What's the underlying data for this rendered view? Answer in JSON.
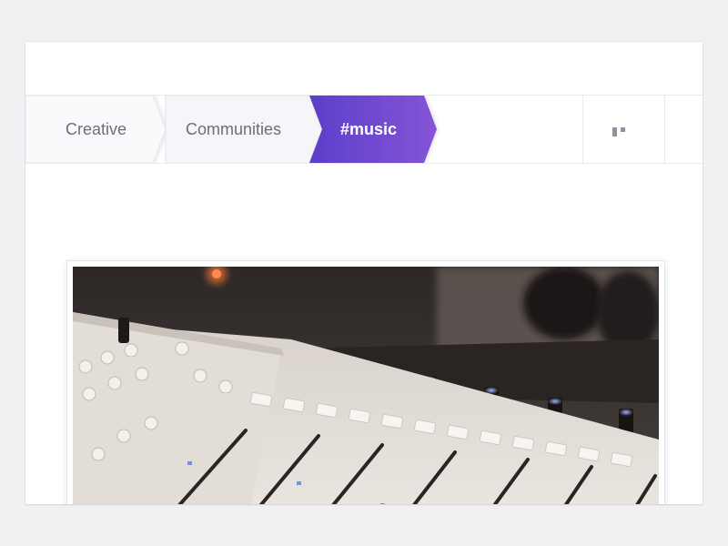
{
  "breadcrumb": {
    "items": [
      {
        "label": "Creative"
      },
      {
        "label": "Communities"
      },
      {
        "label": "#music"
      }
    ],
    "active_gradient": [
      "#5a3fc9",
      "#8a55d8"
    ]
  },
  "more_button": {
    "icon": "more-horizontal-icon"
  },
  "photo": {
    "subject": "mixing-console-photo"
  }
}
